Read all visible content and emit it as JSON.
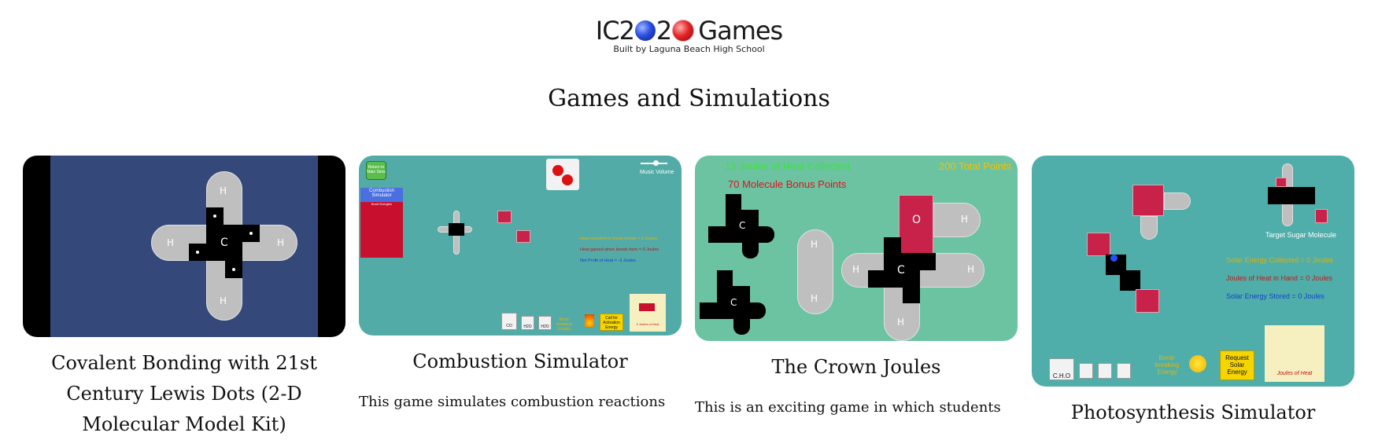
{
  "logo": {
    "prefix": "IC2",
    "middle": "2",
    "suffix": "Games",
    "subtitle": "Built by Laguna Beach High School"
  },
  "heading": "Games and Simulations",
  "cards": [
    {
      "title": "Covalent Bonding with 21st Century Lewis Dots (2-D Molecular Model Kit)",
      "atoms": {
        "center": "C",
        "top": "H",
        "bottom": "H",
        "left": "H",
        "right": "H"
      }
    },
    {
      "title": "Combustion Simulator",
      "description": "This game simulates combustion reactions involving hydrocarbons, oxygen, carbon",
      "return_button": "Return to Main Sims",
      "music_label": "Music Volume",
      "panel_title": "Combustion Simulator",
      "bond_energies_label": "Bond Energies",
      "hud_heat_invested": "Heat invested to break bonds = 0 Joules",
      "hud_heat_gained": "Heat gained when bonds form = 0 Joules",
      "hud_net_profit": "Net Profit of Heat = -3 Joules",
      "bond_breaking": "Bond-breaking Energy",
      "activation_button": "Call for Activation Energy",
      "heat_box": "3 Joules of Heat",
      "molecule_buttons": [
        "CO",
        "H2O",
        "H2O"
      ]
    },
    {
      "title": "The Crown Joules",
      "description": "This is an exciting game in which students",
      "heat_collected": "13 Joules of Heat Collected",
      "total_points": "200 Total Points",
      "bonus_points": "70 Molecule Bonus Points",
      "atoms": {
        "c1": "C",
        "c2": "C",
        "h_top": "H",
        "h_bottom": "H",
        "o": "O",
        "h_o": "H",
        "c3": "C",
        "h_left": "H",
        "h_right": "H",
        "h_down": "H"
      }
    },
    {
      "title": "Photosynthesis Simulator",
      "target": "Target Sugar Molecule",
      "solar_collected": "Solar Energy Collected = 0 Joules",
      "joules_in_hand": "Joules of Heat in Hand = 0 Joules",
      "solar_stored": "Solar Energy Stored = 0 Joules",
      "bond_breaking": "Bond-breaking Energy",
      "request_button": "Request Solar Energy",
      "heat_box": "Joules of Heat",
      "cho_button": "C.H.O",
      "colors": {
        "solar_collected": "#e0b000",
        "joules_in_hand": "#c21818",
        "solar_stored": "#1840d0"
      }
    }
  ]
}
